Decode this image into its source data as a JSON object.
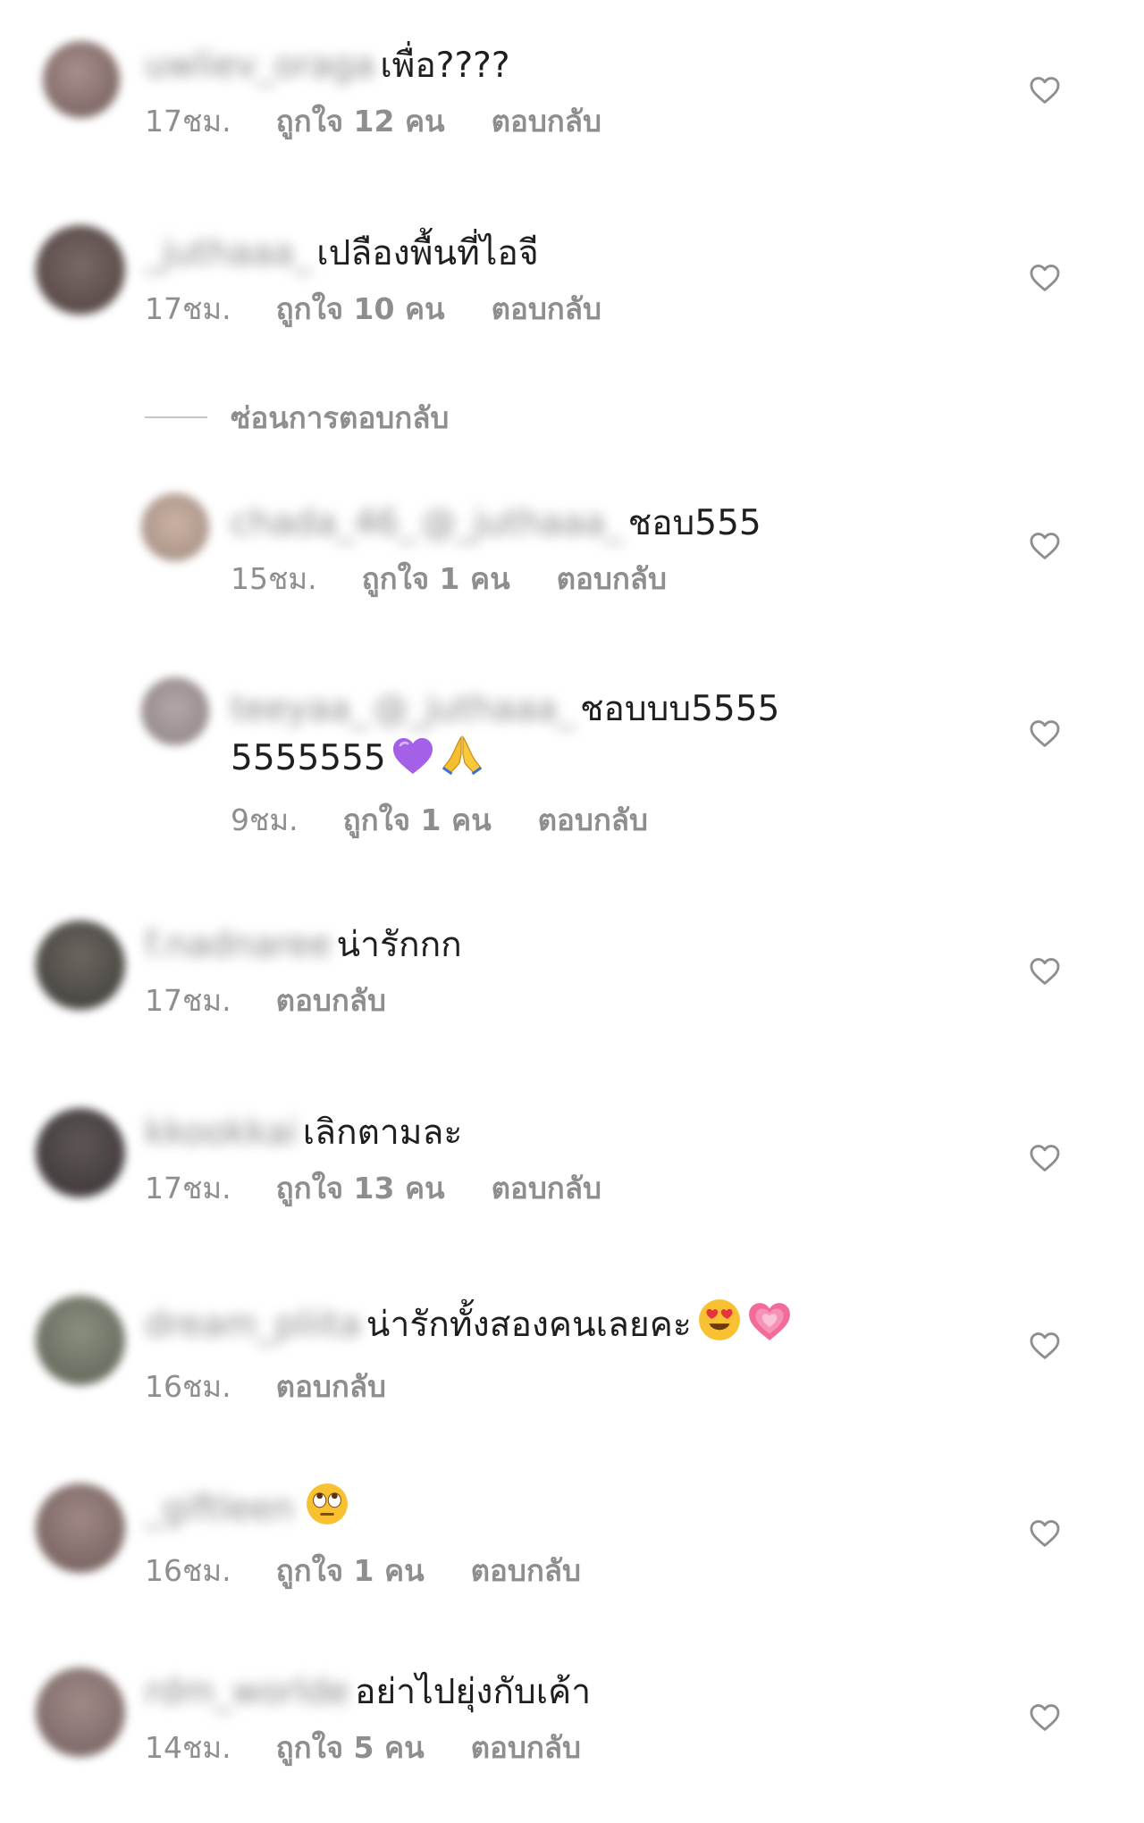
{
  "reply_label": "ตอบกลับ",
  "hide_replies_label": "ซ่อนการตอบกลับ",
  "comments": [
    {
      "username": "uwliev_oraga",
      "text": "เพื่อ????",
      "time": "17ชม.",
      "likes": "ถูกใจ 12 คน"
    },
    {
      "username": "_juthaaa_",
      "text": "เปลืองพื้นที่ไอจี",
      "time": "17ชม.",
      "likes": "ถูกใจ 10 คน"
    },
    {
      "username": "chada_46_",
      "mention": "@_juthaaa_",
      "text": "ชอบ555",
      "time": "15ชม.",
      "likes": "ถูกใจ 1 คน"
    },
    {
      "username": "teeyaa_",
      "mention": "@_juthaaa_",
      "text": "ชอบบบ55555555555",
      "emoji": [
        "purple-heart",
        "folded-hands"
      ],
      "time": "9ชม.",
      "likes": "ถูกใจ 1 คน"
    },
    {
      "username": "f.nadnaree",
      "text": "น่ารักกก",
      "time": "17ชม.",
      "likes": ""
    },
    {
      "username": "kkookkai",
      "text": "เลิกตามละ",
      "time": "17ชม.",
      "likes": "ถูกใจ 13 คน"
    },
    {
      "username": "dream_pliita",
      "text": "น่ารักทั้งสองคนเลยคะ",
      "emoji": [
        "heart-eyes",
        "growing-heart"
      ],
      "time": "16ชม.",
      "likes": ""
    },
    {
      "username": "_giftleen",
      "text": "",
      "emoji": [
        "rolling-eyes"
      ],
      "time": "16ชม.",
      "likes": "ถูกใจ 1 คน"
    },
    {
      "username": "rdm_worlde",
      "text": "อย่าไปยุ่งกับเค้า",
      "time": "14ชม.",
      "likes": "ถูกใจ 5 คน"
    }
  ],
  "colors": {
    "text": "#262626",
    "meta": "#8e8e8e",
    "heart_outline": "#8e8e8e"
  }
}
